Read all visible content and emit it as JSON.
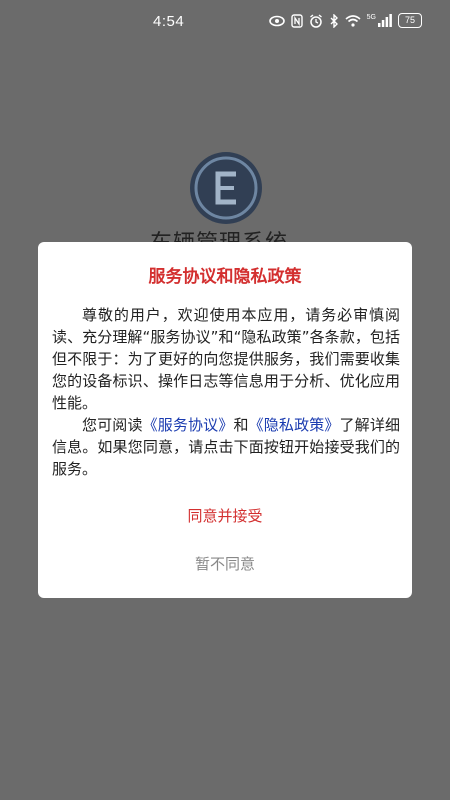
{
  "status_bar": {
    "time": "4:54",
    "battery_level": "75",
    "network_label": "5G",
    "icons": [
      "eye-icon",
      "nfc-icon",
      "alarm-icon",
      "bluetooth-icon",
      "wifi-icon",
      "signal-icon",
      "battery-icon"
    ]
  },
  "app": {
    "name": "车辆管理系统",
    "logo_icon": "app-logo-icon"
  },
  "dialog": {
    "title": "服务协议和隐私政策",
    "paragraph1": "尊敬的用户，欢迎使用本应用，请务必审慎阅读、充分理解“服务协议”和“隐私政策”各条款，包括但不限于：为了更好的向您提供服务，我们需要收集您的设备标识、操作日志等信息用于分析、优化应用性能。",
    "paragraph2_prefix": "您可阅读",
    "service_link": "《服务协议》",
    "paragraph2_and": "和",
    "privacy_link": "《隐私政策》",
    "paragraph2_suffix": "了解详细信息。如果您同意，请点击下面按钮开始接受我们的服务。",
    "accept_label": "同意并接受",
    "decline_label": "暂不同意"
  },
  "colors": {
    "title": "#d32f2f",
    "accept": "#d32f2f",
    "link": "#1a3bb0",
    "decline": "#888888",
    "overlay_background": "#6b6b6b"
  }
}
